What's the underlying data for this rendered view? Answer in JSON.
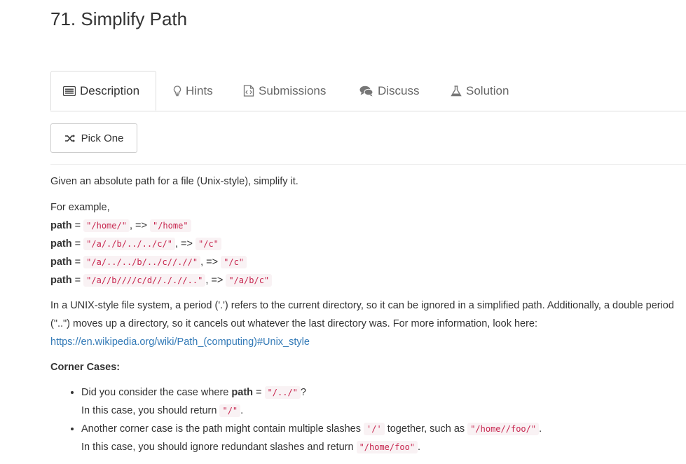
{
  "title": "71. Simplify Path",
  "tabs": [
    {
      "label": "Description",
      "icon": "list-icon"
    },
    {
      "label": "Hints",
      "icon": "lightbulb-icon"
    },
    {
      "label": "Submissions",
      "icon": "code-file-icon"
    },
    {
      "label": "Discuss",
      "icon": "comments-icon"
    },
    {
      "label": "Solution",
      "icon": "flask-icon"
    }
  ],
  "pick_one": {
    "label": "Pick One",
    "icon": "random-icon"
  },
  "intro": "Given an absolute path for a file (Unix-style), simplify it.",
  "example": {
    "heading": "For example,",
    "var": "path",
    "eq": " = ",
    "arrow": ", => ",
    "rows": [
      {
        "input": "\"/home/\"",
        "output": "\"/home\""
      },
      {
        "input": "\"/a/./b/../../c/\"",
        "output": "\"/c\""
      },
      {
        "input": "\"/a/../../b/../c//.//\"",
        "output": "\"/c\""
      },
      {
        "input": "\"/a//b////c/d//././/..\"",
        "output": "\"/a/b/c\""
      }
    ]
  },
  "unix": {
    "text": "In a UNIX-style file system, a period ('.') refers to the current directory, so it can be ignored in a simplified path. Additionally, a double period (\"..\") moves up a directory, so it cancels out whatever the last directory was. For more information, look here: ",
    "link": "https://en.wikipedia.org/wiki/Path_(computing)#Unix_style"
  },
  "corner": {
    "title": "Corner Cases:",
    "case1_pre": "Did you consider the case where ",
    "case1_var": "path",
    "case1_eq": " = ",
    "case1_code": "\"/../\"",
    "case1_end": "?",
    "case1_line2": "In this case, you should return ",
    "case1_ret": "\"/\"",
    "case1_dot": ".",
    "case2_pre": "Another corner case is the path might contain multiple slashes ",
    "case2_code": "'/'",
    "case2_mid": " together, such as ",
    "case2_code2": "\"/home//foo/\"",
    "case2_dot": ".",
    "case2_line2": "In this case, you should ignore redundant slashes and return ",
    "case2_ret": "\"/home/foo\"",
    "case2_dot2": "."
  }
}
